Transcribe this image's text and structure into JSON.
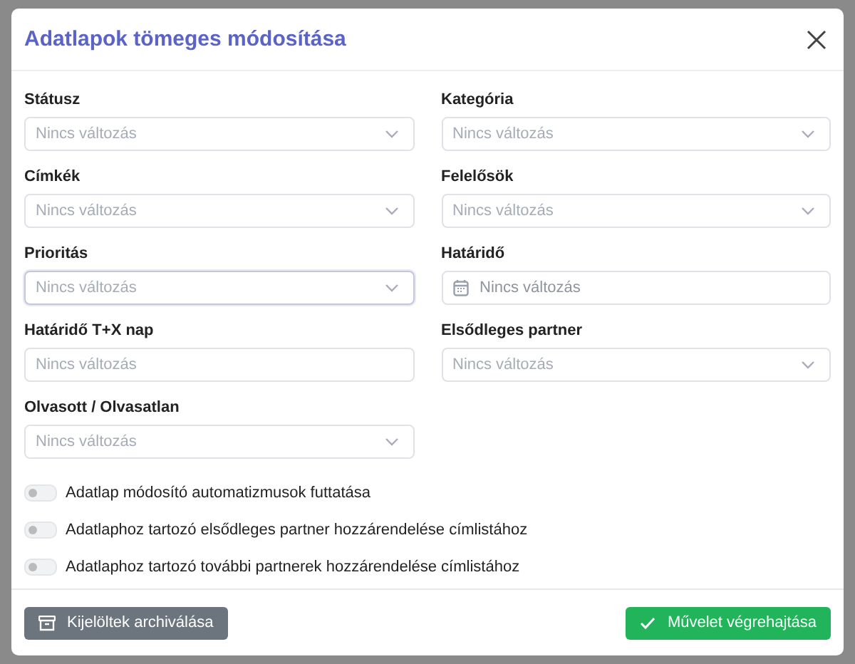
{
  "dialog": {
    "title": "Adatlapok tömeges módosítása"
  },
  "fields": [
    {
      "label": "Státusz",
      "kind": "select",
      "placeholder": "Nincs változás",
      "focused": false
    },
    {
      "label": "Kategória",
      "kind": "select",
      "placeholder": "Nincs változás",
      "focused": false
    },
    {
      "label": "Címkék",
      "kind": "select",
      "placeholder": "Nincs változás",
      "focused": false
    },
    {
      "label": "Felelősök",
      "kind": "select",
      "placeholder": "Nincs változás",
      "focused": false
    },
    {
      "label": "Prioritás",
      "kind": "select",
      "placeholder": "Nincs változás",
      "focused": true
    },
    {
      "label": "Határidő",
      "kind": "date",
      "placeholder": "Nincs változás",
      "focused": false
    },
    {
      "label": "Határidő T+X nap",
      "kind": "text",
      "placeholder": "Nincs változás",
      "focused": false
    },
    {
      "label": "Elsődleges partner",
      "kind": "select",
      "placeholder": "Nincs változás",
      "focused": false
    },
    {
      "label": "Olvasott / Olvasatlan",
      "kind": "select",
      "placeholder": "Nincs változás",
      "focused": false
    }
  ],
  "toggles": [
    {
      "label": "Adatlap módosító automatizmusok futtatása",
      "on": false
    },
    {
      "label": "Adatlaphoz tartozó elsődleges partner hozzárendelése címlistához",
      "on": false
    },
    {
      "label": "Adatlaphoz tartozó további partnerek hozzárendelése címlistához",
      "on": false
    }
  ],
  "buttons": {
    "archive": "Kijelöltek archiválása",
    "submit": "Művelet végrehajtása"
  }
}
